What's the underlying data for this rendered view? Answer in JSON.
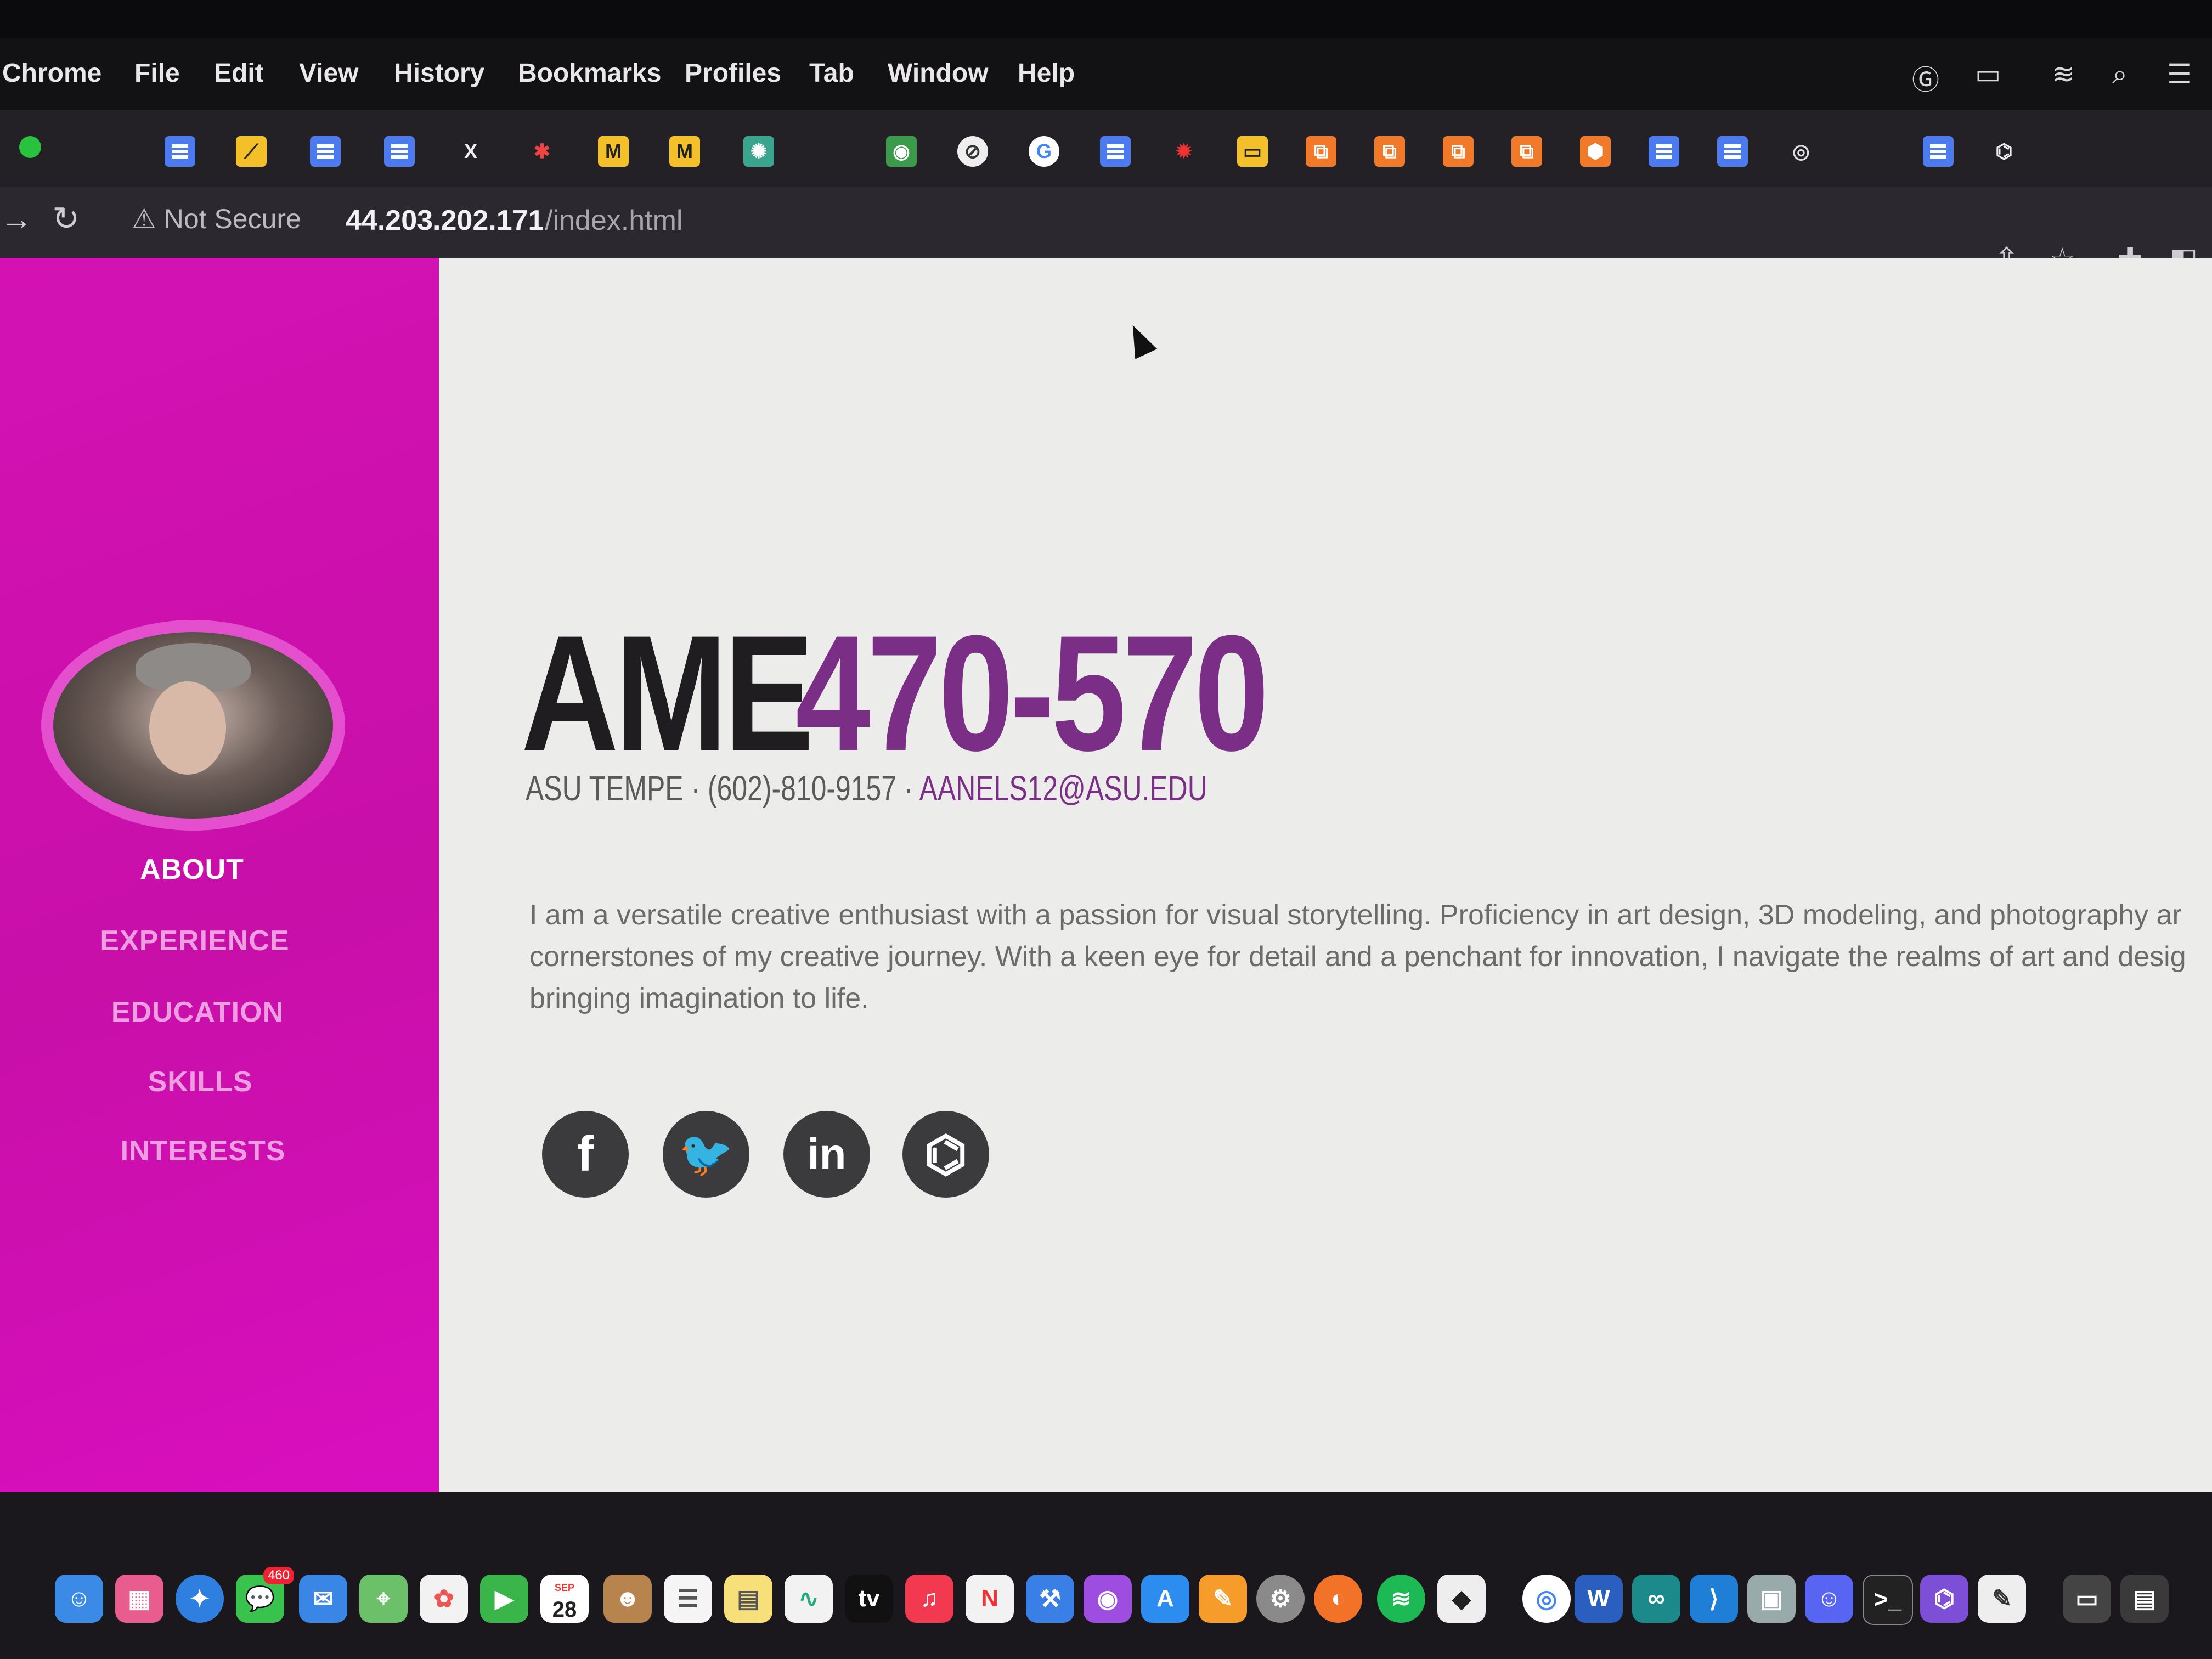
{
  "menubar": {
    "items": [
      "Chrome",
      "File",
      "Edit",
      "View",
      "History",
      "Bookmarks",
      "Profiles",
      "Tab",
      "Window",
      "Help"
    ]
  },
  "addressbar": {
    "security_label": "Not Secure",
    "url_host": "44.203.202.171",
    "url_path": "/index.html"
  },
  "sidebar": {
    "nav": [
      "ABOUT",
      "EXPERIENCE",
      "EDUCATION",
      "SKILLS",
      "INTERESTS"
    ],
    "active_index": 0
  },
  "main": {
    "title_part1": "AME",
    "title_part2": "470-570",
    "subline_location": "ASU TEMPE · (602)-810-9157 · ",
    "subline_email": "AANELS12@ASU.EDU",
    "bio_lines": [
      "I am a versatile creative enthusiast with a passion for visual storytelling. Proficiency in art design, 3D modeling, and photography ar",
      "cornerstones of my creative journey. With a keen eye for detail and a penchant for innovation, I navigate the realms of art and desig",
      "bringing imagination to life."
    ],
    "social": [
      {
        "name": "facebook-icon",
        "glyph": "f"
      },
      {
        "name": "twitter-icon",
        "glyph": "🐦"
      },
      {
        "name": "linkedin-icon",
        "glyph": "in"
      },
      {
        "name": "github-icon",
        "glyph": "⌬"
      }
    ]
  },
  "dock": {
    "calendar_month": "SEP",
    "calendar_day": "28",
    "mail_badge": "460",
    "tv_label": "tv"
  },
  "colors": {
    "sidebar": "#d412b4",
    "accent_purple": "#7b2e86",
    "page_bg": "#ececea"
  }
}
